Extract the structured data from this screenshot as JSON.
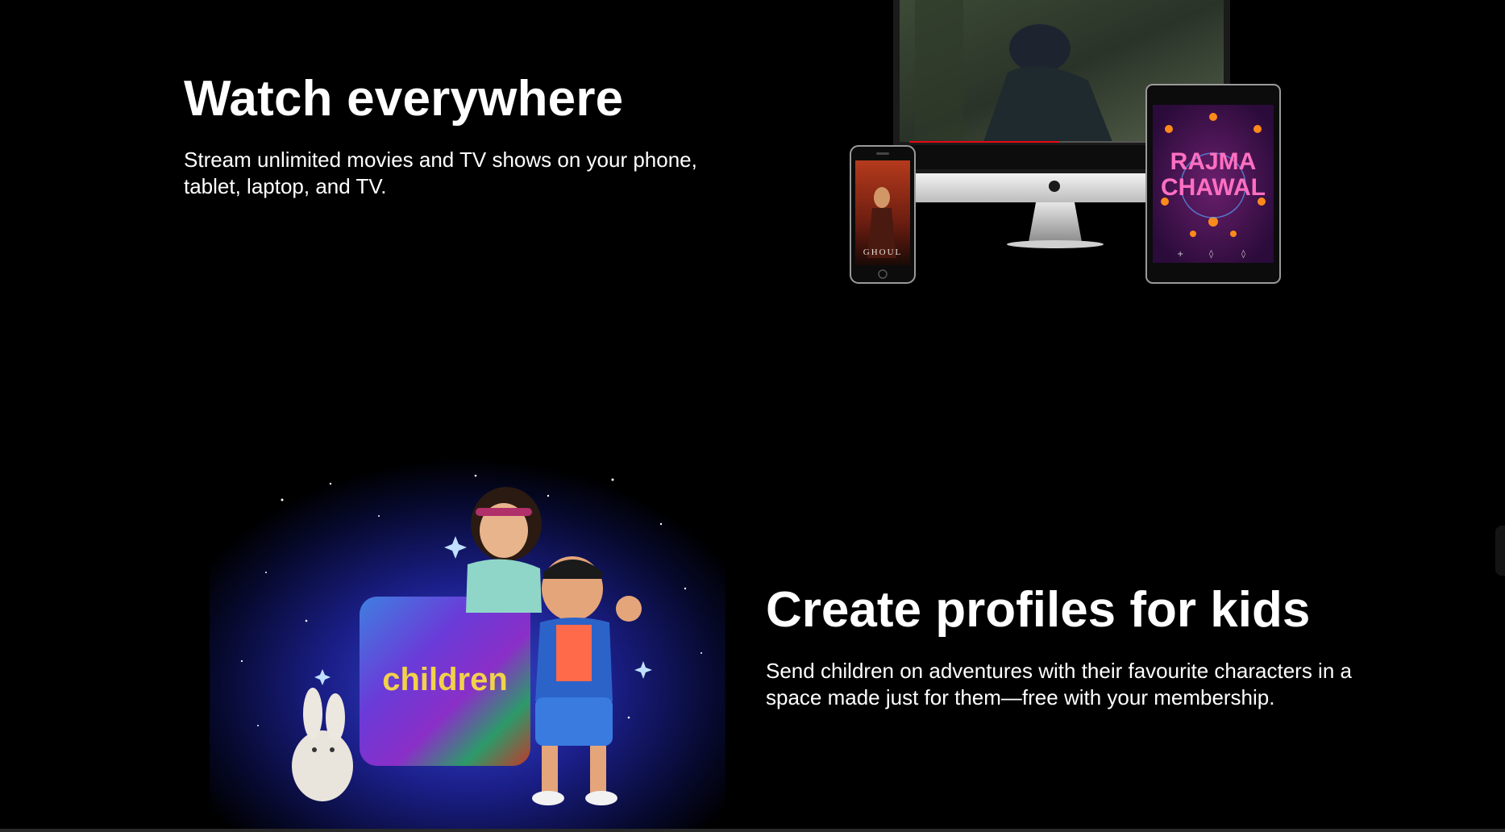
{
  "watch": {
    "title": "Watch everywhere",
    "description": "Stream unlimited movies and TV shows on your phone, tablet, laptop, and TV.",
    "phone_poster_title": "GHOUL",
    "tablet_poster_title_line1": "RAJMA",
    "tablet_poster_title_line2": "CHAWAL"
  },
  "kids": {
    "title": "Create profiles for kids",
    "description": "Send children on adventures with their favourite characters in a space made just for them—free with your membership.",
    "badge_label": "children"
  },
  "colors": {
    "background": "#000000",
    "text": "#ffffff",
    "accent_red": "#e50914",
    "kids_badge_text": "#f1d24a"
  }
}
